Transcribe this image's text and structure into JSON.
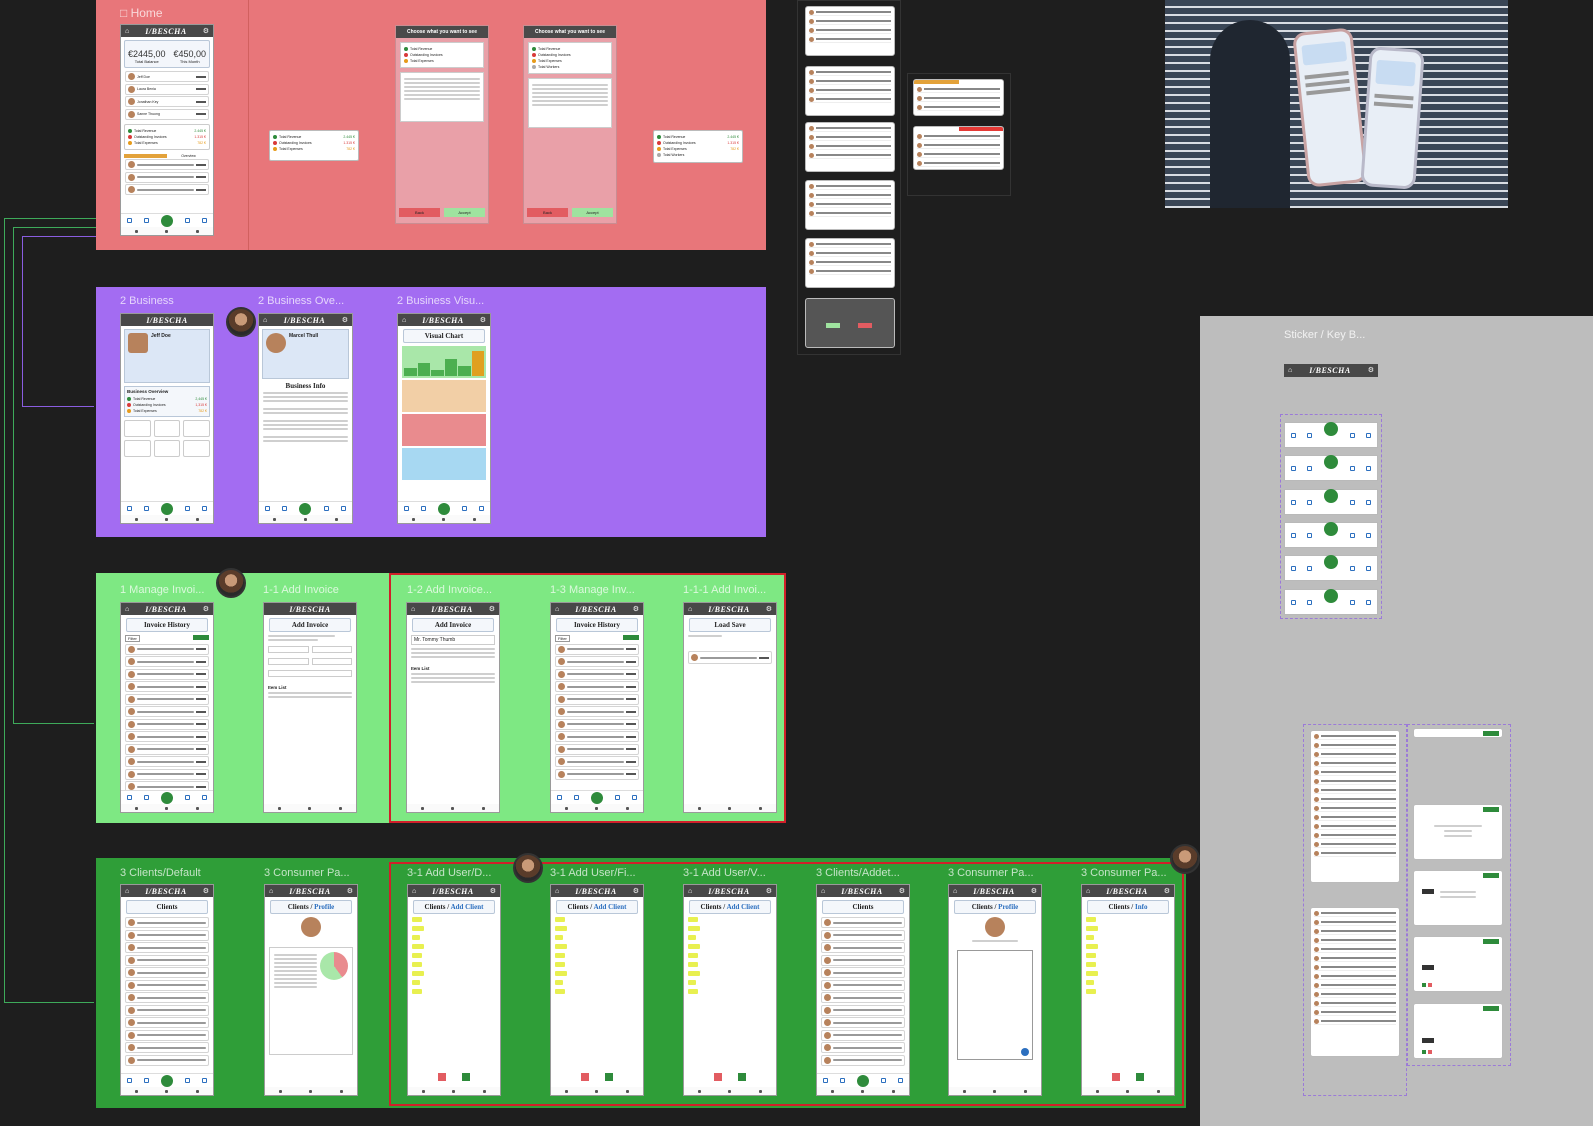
{
  "sections": {
    "home": {
      "label": "Home",
      "color": "#e8767a"
    },
    "business": {
      "labels": [
        "2 Business",
        "2 Business Ove...",
        "2 Business Visu..."
      ],
      "color": "#a36cf2"
    },
    "invoice": {
      "labels": [
        "1 Manage Invoi...",
        "1-1 Add Invoice",
        "1-2 Add Invoice...",
        "1-3 Manage Inv...",
        "1-1-1 Add Invoi..."
      ],
      "color": "#7ee883"
    },
    "clients": {
      "labels": [
        "3 Clients/Default",
        "3 Consumer Pa...",
        "3-1 Add User/D...",
        "3-1 Add User/Fi...",
        "3-1 Add User/V...",
        "3 Clients/Addet...",
        "3 Consumer Pa...",
        "3 Consumer Pa..."
      ],
      "color": "#2f9e38"
    },
    "sticker": {
      "label": "Sticker / Key B...",
      "color": "#bdbdbd"
    }
  },
  "app": {
    "brand": "I/BESCHA",
    "home_icon": "home-icon",
    "settings_icon": "gear-icon"
  },
  "home_screen": {
    "total_balance": "€2445,00",
    "total_balance_label": "Total Balance",
    "this_month": "€450,00",
    "this_month_label": "This Month",
    "clients": [
      "Jeff Doe",
      "Laura Benia",
      "Jonathan Key",
      "Sanne Thuong"
    ],
    "summary": [
      {
        "label": "Total Revenue",
        "value": "2.445 €",
        "color": "#2e8b3b"
      },
      {
        "label": "Outstanding Invoices",
        "value": "1.315 €",
        "color": "#d93a3a"
      },
      {
        "label": "Total Expenses",
        "value": "782 €",
        "color": "#e79b1a"
      }
    ],
    "overview_label": "Overview"
  },
  "modal": {
    "title": "Choose what you want to see",
    "back": "Back",
    "accept": "Accept",
    "items": [
      "Total Revenue",
      "Outstanding Invoices",
      "Total Expenses",
      "Total Workers"
    ]
  },
  "business_screen": {
    "name": "Jeff Doe",
    "overview_title": "Business Overview",
    "overview_items": [
      {
        "label": "Total Revenue",
        "value": "2,445 €",
        "color": "#2e8b3b"
      },
      {
        "label": "Outstanding Invoices",
        "value": "1,315 €",
        "color": "#d93a3a"
      },
      {
        "label": "Total Expenses",
        "value": "782 €",
        "color": "#e79b1a"
      }
    ]
  },
  "business_overview_screen": {
    "name": "Marcel Thull",
    "title": "Business Info"
  },
  "business_visual_screen": {
    "title": "Visual Chart"
  },
  "invoice_screens": {
    "history_title": "Invoice History",
    "add_title": "Add Invoice",
    "load_title": "Load Save",
    "filter_label": "Filter",
    "recipient": "Mr. Tommy Thumb",
    "item_list": "Item List"
  },
  "clients_screens": {
    "clients_title": "Clients",
    "profile_title": "Profile",
    "add_client_title": "Add Client",
    "info_title": "Info",
    "separator": " / "
  },
  "sticker": {
    "brand": "I/BESCHA"
  }
}
